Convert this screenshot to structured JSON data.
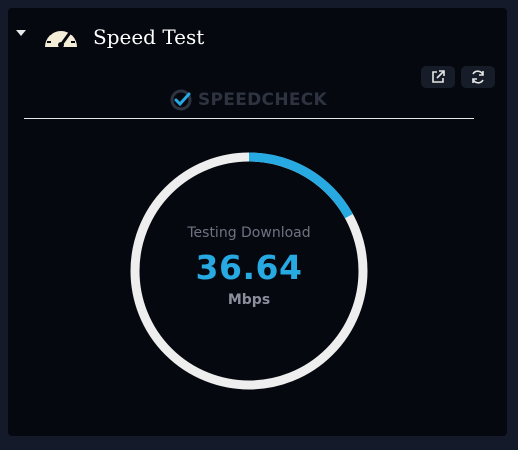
{
  "widget": {
    "title": "Speed Test",
    "icon": "gauge-icon",
    "collapse_icon": "caret-down-icon",
    "actions": [
      {
        "name": "open-external",
        "icon": "external-link-icon"
      },
      {
        "name": "refresh",
        "icon": "refresh-icon"
      }
    ]
  },
  "brand": {
    "text": "SPEEDCHECK",
    "icon": "check-badge-icon"
  },
  "meter": {
    "status": "Testing Download",
    "value": "36.64",
    "unit": "Mbps",
    "progress_fraction": 0.17,
    "track_color": "#eeeeee",
    "progress_color": "#27a9e1"
  },
  "colors": {
    "panel_bg": "#06080f",
    "page_bg": "#141a2a",
    "accent": "#27a9e1"
  }
}
